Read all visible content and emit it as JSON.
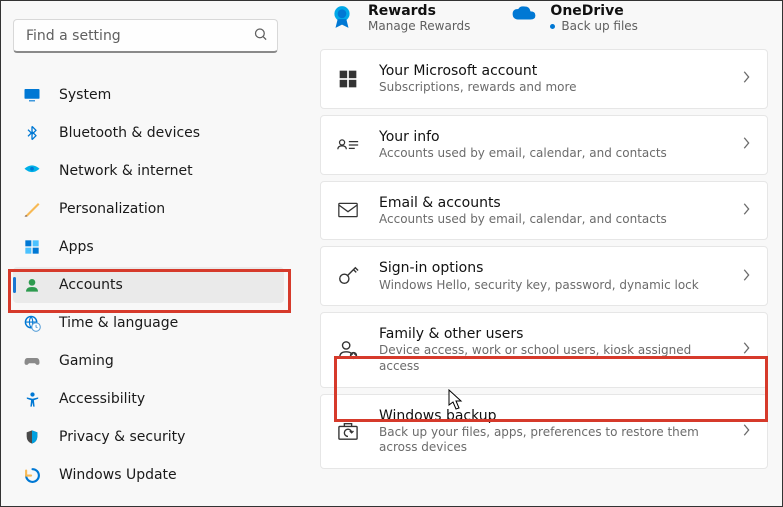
{
  "search": {
    "placeholder": "Find a setting"
  },
  "sidebar": {
    "items": [
      {
        "label": "System"
      },
      {
        "label": "Bluetooth & devices"
      },
      {
        "label": "Network & internet"
      },
      {
        "label": "Personalization"
      },
      {
        "label": "Apps"
      },
      {
        "label": "Accounts"
      },
      {
        "label": "Time & language"
      },
      {
        "label": "Gaming"
      },
      {
        "label": "Accessibility"
      },
      {
        "label": "Privacy & security"
      },
      {
        "label": "Windows Update"
      }
    ]
  },
  "header": {
    "rewards": {
      "title": "Rewards",
      "sub": "Manage Rewards"
    },
    "onedrive": {
      "title": "OneDrive",
      "sub": "Back up files"
    }
  },
  "cards": [
    {
      "title": "Your Microsoft account",
      "sub": "Subscriptions, rewards and more"
    },
    {
      "title": "Your info",
      "sub": "Accounts used by email, calendar, and contacts"
    },
    {
      "title": "Email & accounts",
      "sub": "Accounts used by email, calendar, and contacts"
    },
    {
      "title": "Sign-in options",
      "sub": "Windows Hello, security key, password, dynamic lock"
    },
    {
      "title": "Family & other users",
      "sub": "Device access, work or school users, kiosk assigned access"
    },
    {
      "title": "Windows backup",
      "sub": "Back up your files, apps, preferences to restore them across devices"
    }
  ],
  "colors": {
    "accent": "#1976d2",
    "highlight": "#d63a2b"
  }
}
